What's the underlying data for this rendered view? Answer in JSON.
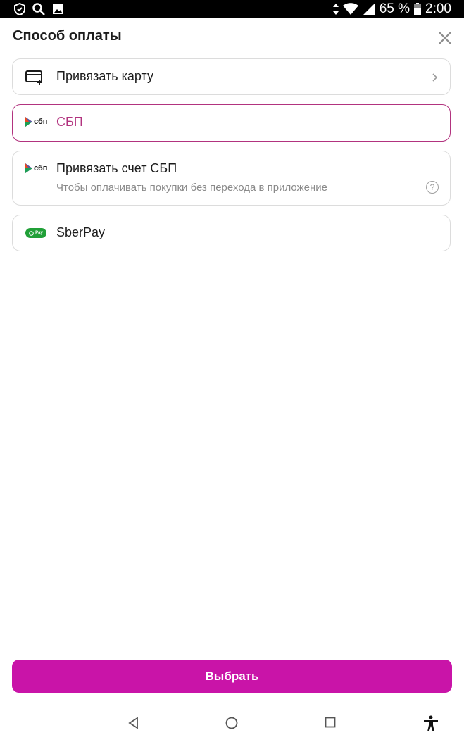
{
  "status_bar": {
    "battery": "65 %",
    "time": "2:00",
    "icons": [
      "shield-icon",
      "search-icon",
      "image-icon",
      "data-arrows-icon",
      "wifi-icon",
      "signal-icon",
      "battery-icon"
    ]
  },
  "sheet": {
    "title": "Способ оплаты",
    "close_icon": "close-icon"
  },
  "options": [
    {
      "label": "Привязать карту",
      "icon": "add-card-icon"
    },
    {
      "label": "СБП",
      "icon": "sbp-logo-icon",
      "selected": true,
      "accent": "#b2337f"
    },
    {
      "label": "Привязать счет СБП",
      "sublabel": "Чтобы оплачивать покупки без перехода в приложение",
      "icon": "sbp-logo-icon"
    },
    {
      "label": "SberPay",
      "icon": "sberpay-logo-icon"
    }
  ],
  "logos": {
    "sbp_text": "сбп",
    "sberpay_text": "Pay"
  },
  "submit": {
    "label": "Выбрать",
    "color": "#c914a8"
  },
  "nav": [
    "back-icon",
    "home-icon",
    "recents-icon",
    "accessibility-icon"
  ]
}
